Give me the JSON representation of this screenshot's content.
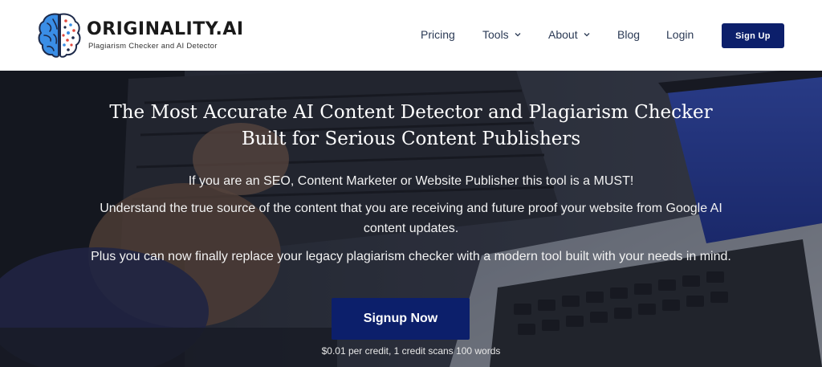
{
  "header": {
    "logo": {
      "title": "ORIGINALITY.AI",
      "subtitle": "Plagiarism Checker and AI Detector"
    },
    "nav": {
      "pricing": "Pricing",
      "tools": "Tools",
      "about": "About",
      "blog": "Blog",
      "login": "Login",
      "signup": "Sign Up"
    }
  },
  "hero": {
    "title": "The Most Accurate AI Content Detector and Plagiarism Checker Built for Serious Content Publishers",
    "p1": "If you are an SEO, Content Marketer or Website Publisher this tool is a MUST!",
    "p2": "Understand the true source of the content that you are receiving and future proof your website from Google AI content updates.",
    "p3": "Plus you can now finally replace your legacy plagiarism checker with a modern tool built with your needs in mind.",
    "cta": "Signup Now",
    "price_note": "$0.01 per credit, 1 credit scans 100 words"
  },
  "colors": {
    "brand_navy": "#0c1f6b",
    "nav_text": "#2b3a55",
    "brain_blue": "#3a8ee6",
    "brain_red": "#e0483e"
  },
  "icons": {
    "logo": "brain-icon",
    "dropdown": "chevron-down-icon"
  }
}
